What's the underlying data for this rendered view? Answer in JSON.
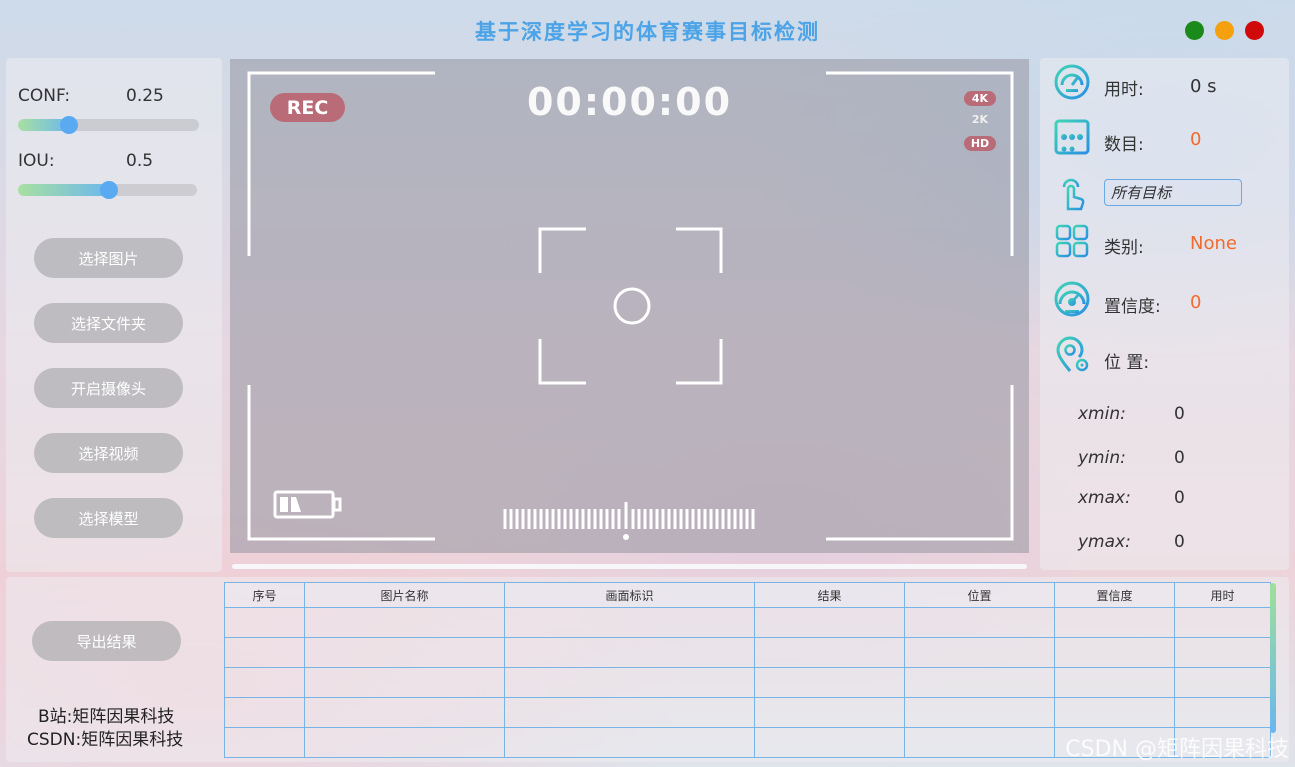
{
  "app": {
    "title": "基于深度学习的体育赛事目标检测"
  },
  "window_controls": {
    "colors": [
      "#1a8a1a",
      "#f5a00f",
      "#d00a0a"
    ]
  },
  "params": {
    "conf": {
      "label": "CONF:",
      "value": "0.25",
      "fraction": 0.25
    },
    "iou": {
      "label": "IOU:",
      "value": "0.5",
      "fraction": 0.5
    }
  },
  "buttons": {
    "select_image": "选择图片",
    "select_folder": "选择文件夹",
    "open_camera": "开启摄像头",
    "select_video": "选择视频",
    "select_model": "选择模型",
    "export": "导出结果"
  },
  "camera": {
    "rec": "REC",
    "timer": "00:00:00",
    "badges": [
      "4K",
      "2K",
      "HD"
    ],
    "progress": 0
  },
  "stats": {
    "time_label": "用时:",
    "time_value": "0 s",
    "count_label": "数目:",
    "count_value": "0",
    "target_select": "所有目标",
    "class_label": "类别:",
    "class_value": "None",
    "conf_label": "置信度:",
    "conf_value": "0",
    "position_label": "位 置:",
    "coords": [
      {
        "label": "xmin:",
        "value": "0"
      },
      {
        "label": "ymin:",
        "value": "0"
      },
      {
        "label": "xmax:",
        "value": "0"
      },
      {
        "label": "ymax:",
        "value": "0"
      }
    ]
  },
  "table": {
    "headers": [
      "序号",
      "图片名称",
      "画面标识",
      "结果",
      "位置",
      "置信度",
      "用时"
    ],
    "rows": 5
  },
  "footer": {
    "bilibili": "B站:矩阵因果科技",
    "csdn": "CSDN:矩阵因果科技"
  },
  "watermark": "CSDN @矩阵因果科技",
  "colors": {
    "accent": "#4ca3e6",
    "value": "#f26a2c"
  }
}
